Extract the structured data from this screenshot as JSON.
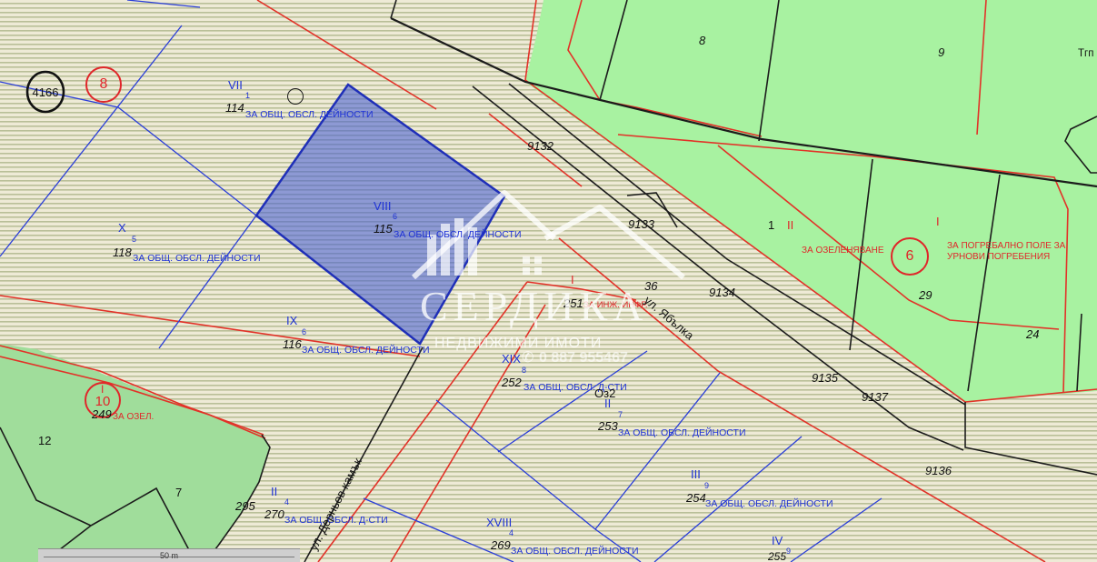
{
  "colors": {
    "ground": "#eeead6",
    "hatch": "#b9bf98",
    "green_zone_right": "#a8f2a1",
    "green_zone_left": "#a0dd9b",
    "parcel_line": "#2a3ed8",
    "regulation_line": "#e23228",
    "road_line": "#1c1c1c",
    "highlight_fill": "#465fd2",
    "highlight_stroke": "#1f2fb8"
  },
  "circles": {
    "plot_4166": "4166",
    "zone_8": "8",
    "zone_10": "10",
    "zone_6": "6"
  },
  "parcels": [
    {
      "zone": "VII",
      "sub": "1",
      "number": "114",
      "purpose": "ЗА ОБЩ. ОБСЛ. ДЕЙНОСТИ"
    },
    {
      "zone": "VIII",
      "sub": "6",
      "number": "115",
      "purpose": "ЗА ОБЩ. ОБСЛ. ДЕЙНОСТИ"
    },
    {
      "zone": "X",
      "sub": "5",
      "number": "118",
      "purpose": "ЗА ОБЩ. ОБСЛ. ДЕЙНОСТИ"
    },
    {
      "zone": "IX",
      "sub": "6",
      "number": "116",
      "purpose": "ЗА ОБЩ. ОБСЛ. ДЕЙНОСТИ"
    },
    {
      "zone": "XIX",
      "sub": "8",
      "number": "252",
      "purpose": "ЗА ОБЩ. ОБСЛ. Д-СТИ"
    },
    {
      "zone": "II",
      "sub": "7",
      "number": "253",
      "purpose": "ЗА ОБЩ. ОБСЛ. ДЕЙНОСТИ"
    },
    {
      "zone": "III",
      "sub": "9",
      "number": "254",
      "purpose": "ЗА ОБЩ. ОБСЛ. ДЕЙНОСТИ"
    },
    {
      "zone": "II",
      "sub": "4",
      "number": "270",
      "purpose": "ЗА ОБЩ. ОБСЛ. Д-СТИ"
    },
    {
      "zone": "XVIII",
      "sub": "4",
      "number": "269",
      "purpose": "ЗА ОБЩ. ОБСЛ. ДЕЙНОСТИ"
    },
    {
      "zone": "IV",
      "sub": "9",
      "number": "255"
    }
  ],
  "red_zones": [
    {
      "roman": "I",
      "number": "249",
      "purpose": "ЗА ОЗЕЛ."
    },
    {
      "roman": "I",
      "number": "251",
      "purpose": "ЗА ИНЖ. ИНФР."
    }
  ],
  "green_zones": [
    {
      "roman": "II",
      "number": "1",
      "purpose": "ЗА ОЗЕЛЕНЯВАНЕ"
    },
    {
      "roman": "I",
      "purpose_line1": "ЗА ПОГРЕБАЛНО ПОЛЕ ЗА",
      "purpose_line2": "УРНОВИ ПОГРЕБЕНИЯ"
    }
  ],
  "plot_numbers": {
    "p12": "12",
    "p7": "7",
    "p295": "295",
    "p36": "36",
    "oz2": "Оз2",
    "p8": "8",
    "p9": "9",
    "tgp": "Тгп",
    "p29": "29",
    "p24": "24"
  },
  "road_ids": [
    "9132",
    "9133",
    "9134",
    "9135",
    "9137",
    "9136"
  ],
  "streets": {
    "yabalka": "ул. Ябълка",
    "dernyov": "ул. Дерньов камък"
  },
  "scale": {
    "label": "50 m"
  },
  "watermark": {
    "brand": "СЕРДИКА",
    "tagline": "НЕДВИЖИМИ ИМОТИ",
    "phone": "0 887 955467"
  }
}
